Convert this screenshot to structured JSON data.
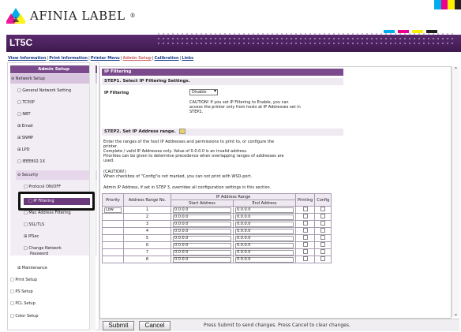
{
  "brand": {
    "name": "AFINIA LABEL",
    "registered": "®",
    "logo_colors": [
      "#00aeef",
      "#ec008c",
      "#fff200",
      "#231f20"
    ]
  },
  "banner": {
    "title": "LT5C"
  },
  "topnav": [
    {
      "label": "View Information",
      "active": false
    },
    {
      "label": "Print Information",
      "active": false
    },
    {
      "label": "Printer Menu",
      "active": false
    },
    {
      "label": "Admin Setup",
      "active": true
    },
    {
      "label": "Calibration",
      "active": false
    },
    {
      "label": "Links",
      "active": false
    }
  ],
  "sidebar": {
    "header": "Admin Setup",
    "items": [
      {
        "label": "Network Setup",
        "prefix": "⊖"
      },
      {
        "label": "General Network Setting",
        "prefix": "□"
      },
      {
        "label": "TCP/IP",
        "prefix": "□"
      },
      {
        "label": "NBT",
        "prefix": "□"
      },
      {
        "label": "Email",
        "prefix": "⊞"
      },
      {
        "label": "SNMP",
        "prefix": "⊞"
      },
      {
        "label": "LPD",
        "prefix": "⊞"
      },
      {
        "label": "IEEE802.1X",
        "prefix": "□"
      },
      {
        "label": "Security",
        "prefix": "⊖"
      },
      {
        "label": "Protocol ON/OFF",
        "prefix": "□"
      },
      {
        "label": "IP Filtering",
        "prefix": "□"
      },
      {
        "label": "Mac Address Filtering",
        "prefix": "□"
      },
      {
        "label": "SSL/TLS",
        "prefix": "□"
      },
      {
        "label": "IPSec",
        "prefix": "⊞"
      },
      {
        "label": "Change Network",
        "prefix": "□"
      },
      {
        "label": "Password",
        "prefix": ""
      },
      {
        "label": "Maintenance",
        "prefix": "⊞"
      },
      {
        "label": "Print Setup",
        "prefix": "□"
      },
      {
        "label": "PS Setup",
        "prefix": "□"
      },
      {
        "label": "PCL Setup",
        "prefix": "□"
      },
      {
        "label": "Color Setup",
        "prefix": "□"
      }
    ]
  },
  "panel": {
    "title": "IP Filtering",
    "step1": "STEP1.  Select IP Filtering Settings.",
    "ip_filtering_label": "IP Filtering",
    "ip_filtering_value": "Disable",
    "caution1": "CAUTION! If you set IP Filtering to Enable, you can",
    "caution2": "access the printer only from hosts at IP Addresses set in",
    "caution3": "STEP2.",
    "step2": "STEP2.  Set IP Address range.",
    "desc1": "Enter the ranges of the host IP Addresses and permissions to print to, or configure the",
    "desc2": "printer.",
    "desc3": "Complete / valid IP Addresses only. Value of 0.0.0.0 is an invalid address.",
    "desc4": "Priorities can be given to determine precedence when overlapping ranges of addresses are",
    "desc5": "used.",
    "caution_head": "(CAUTION!)",
    "caution_body": "When checkbox of \"Config\"is not marked, you can not print with WSD-port.",
    "admin_note": "Admin IP Address, if set in STEP 3, overrides all configuration settings in this section.",
    "table": {
      "col_priority": "Priority",
      "col_range_no": "Address Range No.",
      "col_ip_range": "IP Address Range",
      "col_start": "Start Address",
      "col_end": "End Address",
      "col_printing": "Printing",
      "col_config": "Config",
      "rows": [
        {
          "priority": "Low",
          "no": "1",
          "start": "0.0.0.0",
          "end": "0.0.0.0"
        },
        {
          "priority": "",
          "no": "2",
          "start": "0.0.0.0",
          "end": "0.0.0.0"
        },
        {
          "priority": "",
          "no": "3",
          "start": "0.0.0.0",
          "end": "0.0.0.0"
        },
        {
          "priority": "",
          "no": "4",
          "start": "0.0.0.0",
          "end": "0.0.0.0"
        },
        {
          "priority": "",
          "no": "5",
          "start": "0.0.0.0",
          "end": "0.0.0.0"
        },
        {
          "priority": "",
          "no": "6",
          "start": "0.0.0.0",
          "end": "0.0.0.0"
        },
        {
          "priority": "",
          "no": "7",
          "start": "0.0.0.0",
          "end": "0.0.0.0"
        },
        {
          "priority": "",
          "no": "8",
          "start": "0.0.0.0",
          "end": "0.0.0.0"
        }
      ]
    }
  },
  "footer": {
    "submit": "Submit",
    "cancel": "Cancel",
    "message": "Press Submit to send changes. Press Cancel to clear changes."
  }
}
